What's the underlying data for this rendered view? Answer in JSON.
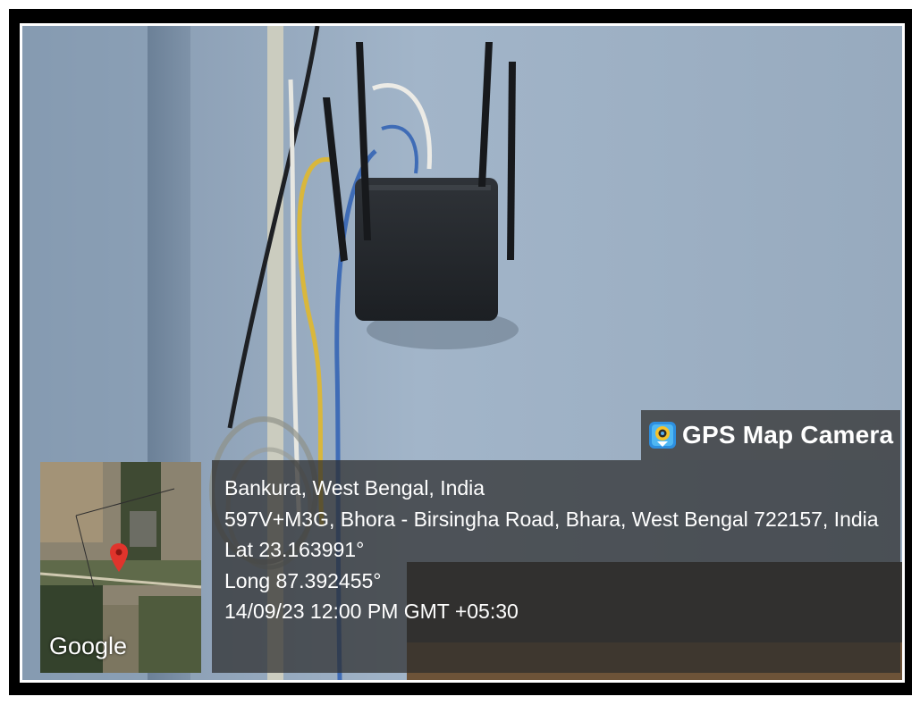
{
  "brand": {
    "name": "GPS Map Camera",
    "icon": "gps-map-camera-app-icon"
  },
  "map": {
    "provider_logo": "Google",
    "marker_icon": "location-pin-icon",
    "marker_color": "#e0342c"
  },
  "location": {
    "place": "Bankura, West Bengal, India",
    "address": "597V+M3G, Bhora - Birsingha Road, Bhara, West Bengal 722157, India",
    "latitude": "Lat 23.163991°",
    "longitude": "Long 87.392455°",
    "timestamp": "14/09/23 12:00 PM GMT +05:30"
  }
}
